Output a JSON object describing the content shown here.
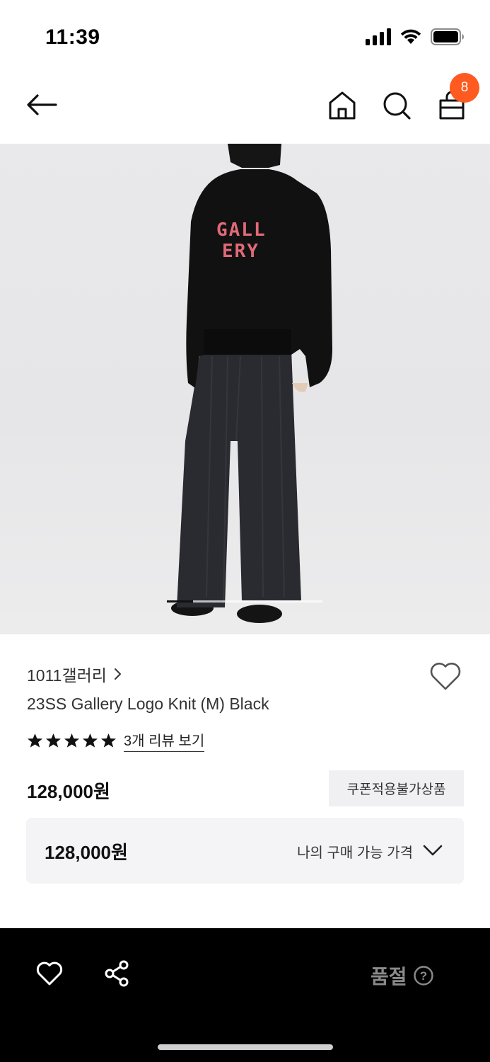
{
  "status_bar": {
    "time": "11:39"
  },
  "nav": {
    "cart_count": "8"
  },
  "product": {
    "brand": "1011갤러리",
    "title": "23SS Gallery Logo Knit (M) Black",
    "rating_stars": 5,
    "review_link": "3개 리뷰 보기",
    "price": "128,000원",
    "coupon_badge": "쿠폰적용불가상품",
    "my_price": {
      "value": "128,000원",
      "label": "나의 구매 가능 가격"
    },
    "image_index_fraction": 0.17
  },
  "bottom_bar": {
    "status_label": "품절",
    "help_glyph": "?"
  },
  "colors": {
    "badge": "#ff5a1f",
    "bottom_bar": "#000000",
    "soldout_text": "#8a8a8a"
  }
}
